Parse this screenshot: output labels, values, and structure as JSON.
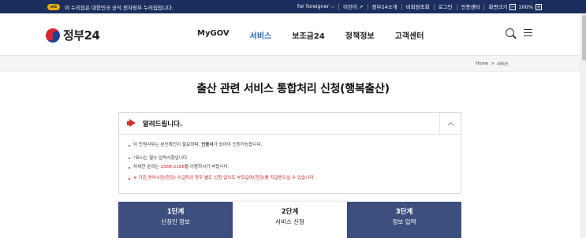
{
  "topbar": {
    "eg_logo": "eG",
    "official_notice": "이 누리집은 대한민국 공식 전자정부 누리집입니다.",
    "links": [
      "for foreigner",
      "이런이",
      "정부24소개",
      "비회원조회",
      "로그인",
      "인증센터"
    ],
    "zoom_label": "화면크기",
    "zoom_minus": "−",
    "zoom_value": "100%",
    "zoom_plus": "+"
  },
  "header": {
    "logo_text": "정부24",
    "nav": [
      "MyGOV",
      "서비스",
      "보조금24",
      "정책정보",
      "고객센터"
    ],
    "active_nav": "서비스"
  },
  "breadcrumb": {
    "home": "Home",
    "separator": ">",
    "current": "서비스"
  },
  "page_title": "출산 관련 서비스 통합처리 신청(행복출산)",
  "notice": {
    "title": "알려드립니다.",
    "line1_prefix": "이 민원사무는 본인확인이 필요하며, ",
    "line1_bold": "인증서",
    "line1_suffix": "가 있어야 신청가능합니다.",
    "line2_prefix": "",
    "line2_star": "*",
    "line2_suffix": "표시는 필수 입력사항입니다.",
    "line3_prefix": "자세한 문의는 ",
    "line3_phone": "1588-2188",
    "line3_suffix": "을 이용하시기 바랍니다.",
    "line4": "※ 기존 영아수당(현금) 수급자의 경우 별도 신청 없이도 부모급여(현금)를 지급받으실 수 있습니다."
  },
  "steps": [
    {
      "number": "1단계",
      "label": "신청인 정보"
    },
    {
      "number": "2단계",
      "label": "서비스 신청"
    },
    {
      "number": "3단계",
      "label": "정보 입력"
    }
  ],
  "current_step": 2,
  "colors": {
    "topbar_bg": "#1b2e5e",
    "accent_blue": "#2563b8",
    "step_bg": "#3c4f7e",
    "notice_red": "#d42020"
  }
}
